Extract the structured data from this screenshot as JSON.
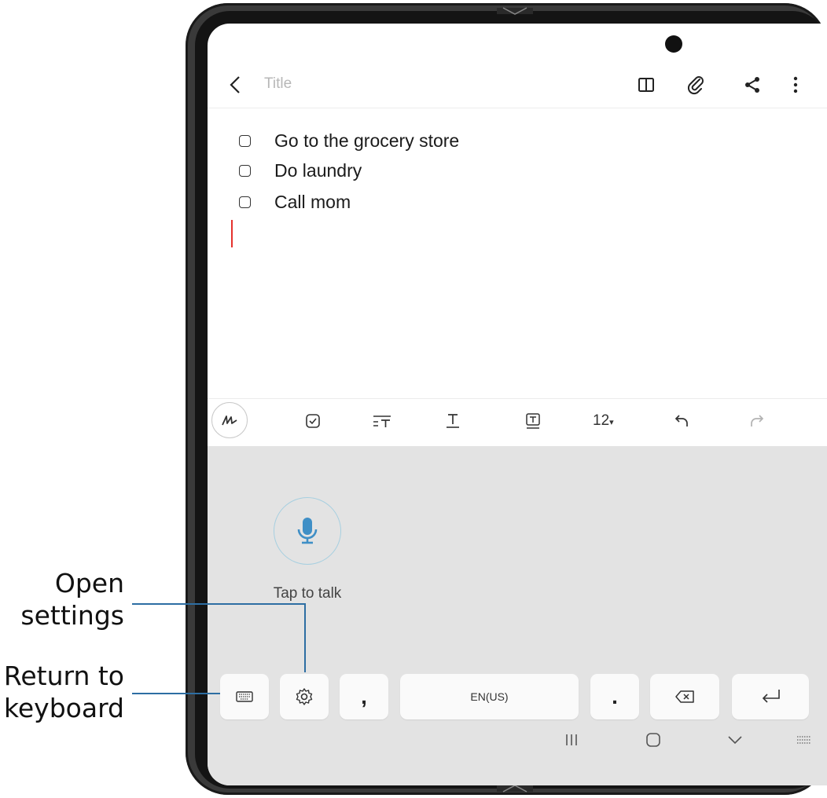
{
  "header": {
    "back_icon": "chevron-left-icon",
    "title_placeholder": "Title",
    "icons": [
      "book-view-icon",
      "paperclip-icon",
      "share-icon",
      "more-vertical-icon"
    ]
  },
  "checklist": {
    "items": [
      {
        "label": "Go to the grocery store",
        "checked": false
      },
      {
        "label": "Do laundry",
        "checked": false
      },
      {
        "label": "Call mom",
        "checked": false
      }
    ]
  },
  "toolbar": {
    "icons": [
      "handwriting-pen-icon",
      "checkbox-icon",
      "text-align-icon",
      "underline-text-icon",
      "text-box-icon",
      "undo-icon",
      "redo-icon"
    ],
    "font_size": "12",
    "font_size_caret": "▾"
  },
  "voice_input": {
    "mic_icon": "microphone-icon",
    "prompt": "Tap to talk"
  },
  "keyboard_row": {
    "keyboard_icon": "keyboard-icon",
    "settings_icon": "gear-icon",
    "comma": ",",
    "language": "EN(US)",
    "period": ".",
    "backspace_icon": "backspace-icon",
    "enter_icon": "enter-icon"
  },
  "navbar": {
    "icons": [
      "recents-icon",
      "home-icon",
      "hide-keyboard-chevron-icon",
      "keyboard-switch-icon"
    ]
  },
  "callouts": {
    "open_settings": [
      "Open",
      "settings"
    ],
    "return_to_keyboard": [
      "Return to",
      "keyboard"
    ]
  },
  "colors": {
    "accent_blue": "#2d6ea3",
    "mic_blue": "#3f8fc6",
    "cursor_red": "#e5322d",
    "keyboard_bg": "#e3e3e3"
  }
}
